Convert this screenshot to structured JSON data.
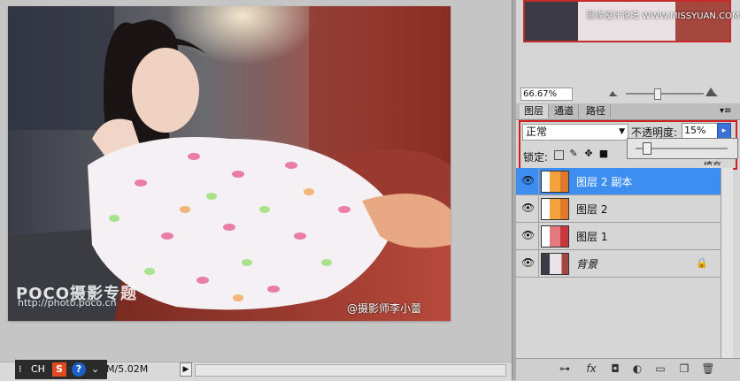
{
  "canvas": {
    "watermark_brand": "POCO摄影专题",
    "watermark_url": "http://photo.poco.cn",
    "author_credit": "@摄影师李小蕾"
  },
  "status_bar": {
    "doc_size": "M/5.02M",
    "arrow_icon": "play-icon"
  },
  "ime": {
    "lang": "CH",
    "s_label": "S",
    "help_label": "?"
  },
  "navigator": {
    "credit": "思缘设计论坛 WWW.MISSYUAN.COM",
    "zoom": "66.67%"
  },
  "panel_tabs": [
    {
      "label": "图层"
    },
    {
      "label": "通道"
    },
    {
      "label": "路径"
    }
  ],
  "blend": {
    "mode": "正常",
    "opacity_label": "不透明度:",
    "opacity_value": "15%",
    "lock_label": "锁定:",
    "fill_fragment": "填充"
  },
  "layers": [
    {
      "name": "图层 2 副本",
      "selected": true
    },
    {
      "name": "图层 2",
      "selected": false
    },
    {
      "name": "图层 1",
      "selected": false
    },
    {
      "name": "背景",
      "selected": false,
      "locked": true
    }
  ],
  "colors": {
    "highlight_red": "#d01f1f",
    "selection_blue": "#3d8ef0"
  }
}
